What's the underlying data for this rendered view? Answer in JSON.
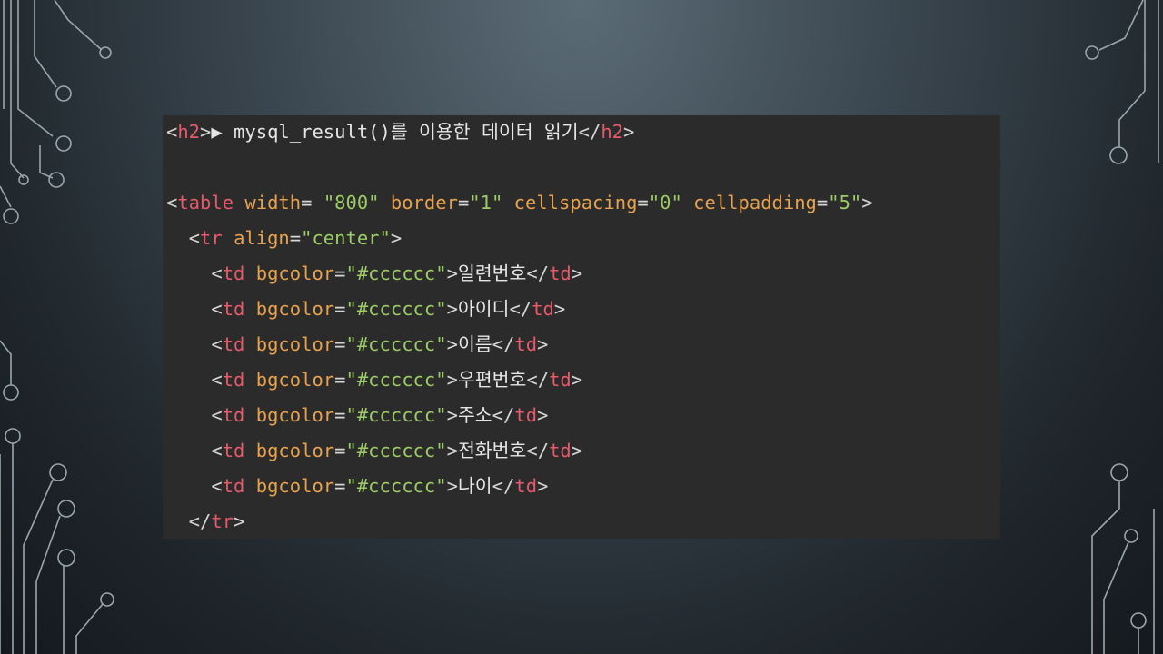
{
  "slide": {
    "code_lines": [
      [
        {
          "t": "<",
          "c": "p"
        },
        {
          "t": "h2",
          "c": "t"
        },
        {
          "t": ">",
          "c": "p"
        },
        {
          "t": "▶ mysql_result()를 이용한 데이터 읽기",
          "c": "x"
        },
        {
          "t": "</",
          "c": "p"
        },
        {
          "t": "h2",
          "c": "t"
        },
        {
          "t": ">",
          "c": "p"
        }
      ],
      [],
      [
        {
          "t": "<",
          "c": "p"
        },
        {
          "t": "table",
          "c": "t"
        },
        {
          "t": " ",
          "c": "p"
        },
        {
          "t": "width",
          "c": "a"
        },
        {
          "t": "= ",
          "c": "p"
        },
        {
          "t": "\"800\"",
          "c": "s"
        },
        {
          "t": " ",
          "c": "p"
        },
        {
          "t": "border",
          "c": "a"
        },
        {
          "t": "=",
          "c": "p"
        },
        {
          "t": "\"1\"",
          "c": "s"
        },
        {
          "t": " ",
          "c": "p"
        },
        {
          "t": "cellspacing",
          "c": "a"
        },
        {
          "t": "=",
          "c": "p"
        },
        {
          "t": "\"0\"",
          "c": "s"
        },
        {
          "t": " ",
          "c": "p"
        },
        {
          "t": "cellpadding",
          "c": "a"
        },
        {
          "t": "=",
          "c": "p"
        },
        {
          "t": "\"5\"",
          "c": "s"
        },
        {
          "t": ">",
          "c": "p"
        }
      ],
      [
        {
          "t": "  <",
          "c": "p"
        },
        {
          "t": "tr",
          "c": "t"
        },
        {
          "t": " ",
          "c": "p"
        },
        {
          "t": "align",
          "c": "a"
        },
        {
          "t": "=",
          "c": "p"
        },
        {
          "t": "\"center\"",
          "c": "s"
        },
        {
          "t": ">",
          "c": "p"
        }
      ],
      [
        {
          "t": "    <",
          "c": "p"
        },
        {
          "t": "td",
          "c": "t"
        },
        {
          "t": " ",
          "c": "p"
        },
        {
          "t": "bgcolor",
          "c": "a"
        },
        {
          "t": "=",
          "c": "p"
        },
        {
          "t": "\"#cccccc\"",
          "c": "s"
        },
        {
          "t": ">",
          "c": "p"
        },
        {
          "t": "일련번호",
          "c": "x"
        },
        {
          "t": "</",
          "c": "p"
        },
        {
          "t": "td",
          "c": "t"
        },
        {
          "t": ">",
          "c": "p"
        }
      ],
      [
        {
          "t": "    <",
          "c": "p"
        },
        {
          "t": "td",
          "c": "t"
        },
        {
          "t": " ",
          "c": "p"
        },
        {
          "t": "bgcolor",
          "c": "a"
        },
        {
          "t": "=",
          "c": "p"
        },
        {
          "t": "\"#cccccc\"",
          "c": "s"
        },
        {
          "t": ">",
          "c": "p"
        },
        {
          "t": "아이디",
          "c": "x"
        },
        {
          "t": "</",
          "c": "p"
        },
        {
          "t": "td",
          "c": "t"
        },
        {
          "t": ">",
          "c": "p"
        }
      ],
      [
        {
          "t": "    <",
          "c": "p"
        },
        {
          "t": "td",
          "c": "t"
        },
        {
          "t": " ",
          "c": "p"
        },
        {
          "t": "bgcolor",
          "c": "a"
        },
        {
          "t": "=",
          "c": "p"
        },
        {
          "t": "\"#cccccc\"",
          "c": "s"
        },
        {
          "t": ">",
          "c": "p"
        },
        {
          "t": "이름",
          "c": "x"
        },
        {
          "t": "</",
          "c": "p"
        },
        {
          "t": "td",
          "c": "t"
        },
        {
          "t": ">",
          "c": "p"
        }
      ],
      [
        {
          "t": "    <",
          "c": "p"
        },
        {
          "t": "td",
          "c": "t"
        },
        {
          "t": " ",
          "c": "p"
        },
        {
          "t": "bgcolor",
          "c": "a"
        },
        {
          "t": "=",
          "c": "p"
        },
        {
          "t": "\"#cccccc\"",
          "c": "s"
        },
        {
          "t": ">",
          "c": "p"
        },
        {
          "t": "우편번호",
          "c": "x"
        },
        {
          "t": "</",
          "c": "p"
        },
        {
          "t": "td",
          "c": "t"
        },
        {
          "t": ">",
          "c": "p"
        }
      ],
      [
        {
          "t": "    <",
          "c": "p"
        },
        {
          "t": "td",
          "c": "t"
        },
        {
          "t": " ",
          "c": "p"
        },
        {
          "t": "bgcolor",
          "c": "a"
        },
        {
          "t": "=",
          "c": "p"
        },
        {
          "t": "\"#cccccc\"",
          "c": "s"
        },
        {
          "t": ">",
          "c": "p"
        },
        {
          "t": "주소",
          "c": "x"
        },
        {
          "t": "</",
          "c": "p"
        },
        {
          "t": "td",
          "c": "t"
        },
        {
          "t": ">",
          "c": "p"
        }
      ],
      [
        {
          "t": "    <",
          "c": "p"
        },
        {
          "t": "td",
          "c": "t"
        },
        {
          "t": " ",
          "c": "p"
        },
        {
          "t": "bgcolor",
          "c": "a"
        },
        {
          "t": "=",
          "c": "p"
        },
        {
          "t": "\"#cccccc\"",
          "c": "s"
        },
        {
          "t": ">",
          "c": "p"
        },
        {
          "t": "전화번호",
          "c": "x"
        },
        {
          "t": "</",
          "c": "p"
        },
        {
          "t": "td",
          "c": "t"
        },
        {
          "t": ">",
          "c": "p"
        }
      ],
      [
        {
          "t": "    <",
          "c": "p"
        },
        {
          "t": "td",
          "c": "t"
        },
        {
          "t": " ",
          "c": "p"
        },
        {
          "t": "bgcolor",
          "c": "a"
        },
        {
          "t": "=",
          "c": "p"
        },
        {
          "t": "\"#cccccc\"",
          "c": "s"
        },
        {
          "t": ">",
          "c": "p"
        },
        {
          "t": "나이",
          "c": "x"
        },
        {
          "t": "</",
          "c": "p"
        },
        {
          "t": "td",
          "c": "t"
        },
        {
          "t": ">",
          "c": "p"
        }
      ],
      [
        {
          "t": "  </",
          "c": "p"
        },
        {
          "t": "tr",
          "c": "t"
        },
        {
          "t": ">",
          "c": "p"
        }
      ]
    ]
  },
  "colors": {
    "panel_bg": "#2b2b2b",
    "tag": "#e8596a",
    "attribute": "#e8a24e",
    "string": "#9ccc65",
    "punctuation": "#d6d6d6",
    "text": "#e6e6e6",
    "circuit": "#9aa6ad"
  }
}
